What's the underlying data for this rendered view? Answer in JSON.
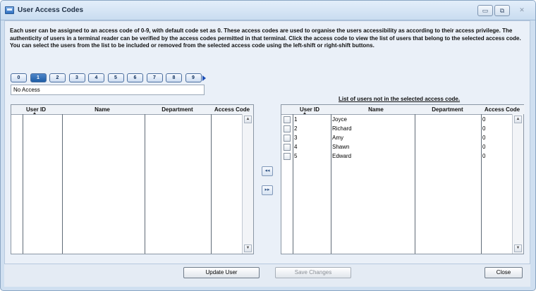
{
  "window": {
    "title": "User Access Codes",
    "min_glyph": "▭",
    "max_glyph": "⧉",
    "close_glyph": "✕"
  },
  "description": "Each user can be assigned to an access code of 0-9, with default code set as 0. These access codes are used to organise the users accessibility as according to their access privilege. The authenticity of users in a terminal reader can be verified by the access codes permitted in that terminal. Click the access code to view the list of users that belong to the selected access code. You can select the users from the list to be included or removed from the selected access code using the left-shift or right-shift buttons.",
  "access_codes": [
    "0",
    "1",
    "2",
    "3",
    "4",
    "5",
    "6",
    "7",
    "8",
    "9"
  ],
  "selected_code_index": 1,
  "code_name": "No Access",
  "right_caption": "List of users not in the selected access code.",
  "columns": {
    "user_id": "User ID",
    "name": "Name",
    "department": "Department",
    "access_code": "Access Code"
  },
  "left_users": [],
  "right_users": [
    {
      "user_id": "1",
      "name": "Joyce",
      "department": "",
      "access_code": "0"
    },
    {
      "user_id": "2",
      "name": "Richard",
      "department": "",
      "access_code": "0"
    },
    {
      "user_id": "3",
      "name": "Amy",
      "department": "",
      "access_code": "0"
    },
    {
      "user_id": "4",
      "name": "Shawn",
      "department": "",
      "access_code": "0"
    },
    {
      "user_id": "5",
      "name": "Edward",
      "department": "",
      "access_code": "0"
    }
  ],
  "move_buttons": {
    "left": "◂◂",
    "right": "▸▸"
  },
  "scroll": {
    "up": "▲",
    "down": "▼"
  },
  "footer": {
    "update_user": "Update User",
    "save_changes": "Save Changes",
    "close": "Close"
  },
  "colors": {
    "accent": "#1e5da6",
    "window_bg": "#cfdff0"
  }
}
